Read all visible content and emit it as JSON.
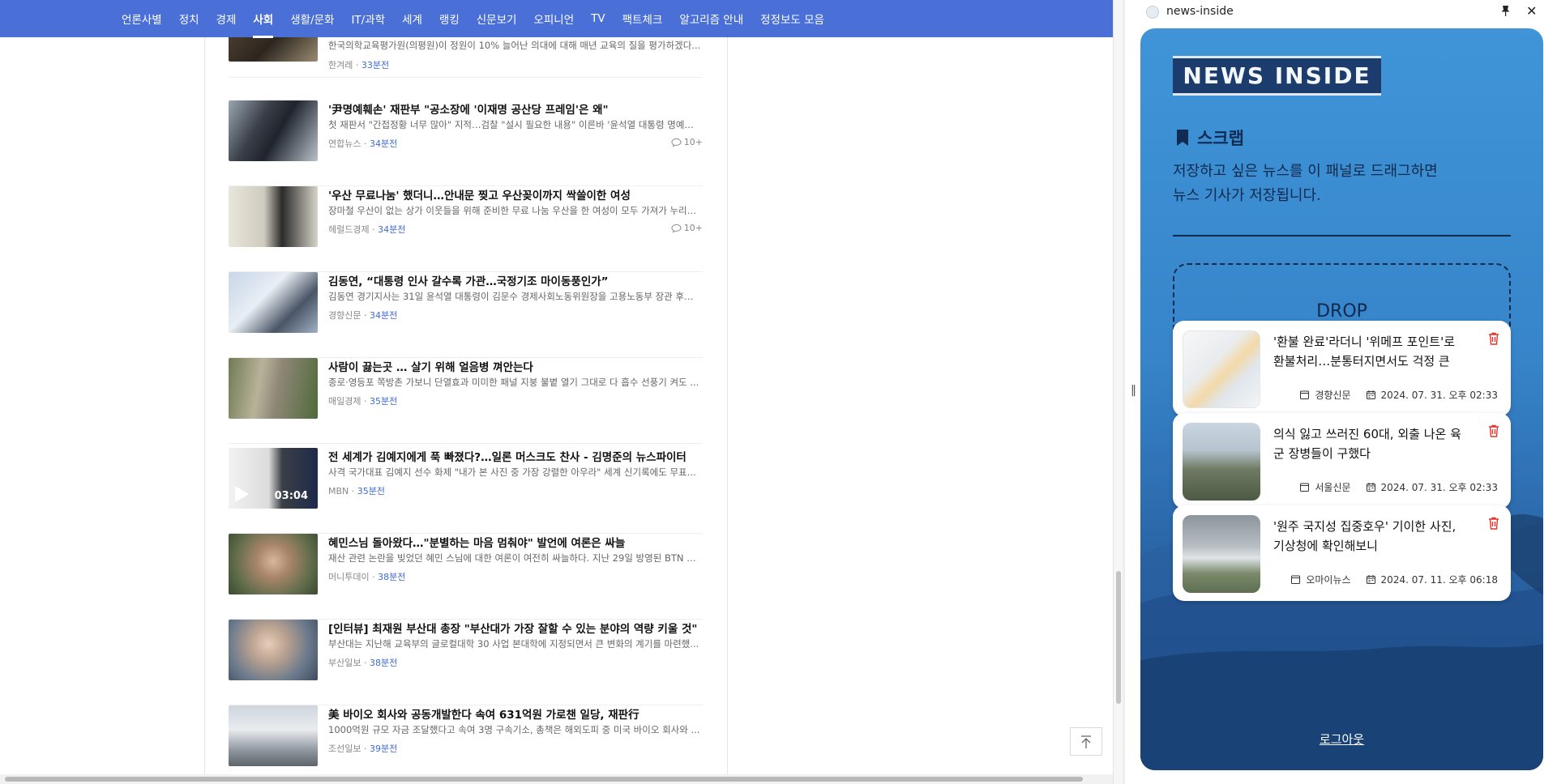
{
  "nav": {
    "items": [
      "언론사별",
      "정치",
      "경제",
      "사회",
      "생활/문화",
      "IT/과학",
      "세계",
      "랭킹",
      "신문보기",
      "오피니언",
      "TV",
      "팩트체크",
      "알고리즘 안내",
      "정정보도 모음"
    ],
    "active": "사회"
  },
  "news": [
    {
      "title": "",
      "desc": "한국의학교육평가원(의평원)이 정원이 10% 늘어난 의대에 대해 매년 교육의 질을 평가하겠다...",
      "source": "한겨레",
      "time": "33분전"
    },
    {
      "title": "'尹명예훼손' 재판부 \"공소장에 '이재명 공산당 프레임'은 왜\"",
      "desc": "첫 재판서 \"간접정황 너무 많아\" 지적…검찰 \"설시 필요한 내용\" 이른바 '윤석열 대통령 명예훼...",
      "source": "연합뉴스",
      "time": "34분전",
      "comments": "10+"
    },
    {
      "title": "'우산 무료나눔' 했더니…안내문 찢고 우산꽂이까지 싹쓸이한 여성",
      "desc": "장마철 우산이 없는 상가 이웃들을 위해 준비한 무료 나눔 우산을 한 여성이 모두 가져가 누리꾼...",
      "source": "헤럴드경제",
      "time": "34분전",
      "comments": "10+"
    },
    {
      "title": "김동연, “대통령 인사 갈수록 가관…국정기조 마이동풍인가”",
      "desc": "김동연 경기지사는 31일 윤석열 대통령이 김문수 경제사회노동위원장을 고용노동부 장관 후보...",
      "source": "경향신문",
      "time": "34분전"
    },
    {
      "title": "사람이 끓는곳 … 살기 위해 얼음병 껴안는다",
      "desc": "종로·영등포 쪽방촌 가보니 단열효과 미미한 패널 지붕 불볕 열기 그대로 다 흡수 선풍기 켜도 ...",
      "source": "매일경제",
      "time": "35분전"
    },
    {
      "title": "전 세계가 김예지에게 푹 빠졌다?…일론 머스크도 찬사 - 김명준의 뉴스파이터",
      "desc": "사격 국가대표 김예지 선수 화제 \"내가 본 사진 중 가장 강렬한 아우라\" 세계 신기록에도 무표...",
      "source": "MBN",
      "time": "35분전",
      "duration": "03:04"
    },
    {
      "title": "혜민스님 돌아왔다…\"분별하는 마음 멈춰야\" 발언에 여론은 싸늘",
      "desc": "재산 관련 논란을 빚었던 혜민 스님에 대한 여론이 여전히 싸늘하다. 지난 29일 방영된 BTN 불...",
      "source": "머니투데이",
      "time": "38분전"
    },
    {
      "title": "[인터뷰] 최재원 부산대 총장 \"부산대가 가장 잘할 수 있는 분야의 역량 키울 것\"",
      "desc": "부산대는 지난해 교육부의 글로컬대학 30 사업 본대학에 지정되면서 큰 변화의 계기를 마련했...",
      "source": "부산일보",
      "time": "38분전"
    },
    {
      "title": "美 바이오 회사와 공동개발한다 속여 631억원 가로챈 일당, 재판行",
      "desc": "1000억원 규모 자금 조달했다고 속여 3명 구속기소, 총책은 해외도피 중 미국 바이오 회사와 ...",
      "source": "조선일보",
      "time": "39분전"
    }
  ],
  "panel": {
    "window_title": "news-inside",
    "brand": "NEWS INSIDE",
    "scrap_heading": "스크랩",
    "scrap_desc_line1": "저장하고 싶은 뉴스를 이 패널로 드래그하면",
    "scrap_desc_line2": "뉴스 기사가 저장됩니다.",
    "drop_label": "DROP",
    "cards": [
      {
        "title": "'환불 완료'라더니 '위메프 포인트'로 환불처리…분통터지면서도 걱정 큰 소...",
        "source": "경향신문",
        "date": "2024. 07. 31. 오후 02:33"
      },
      {
        "title": "의식 잃고 쓰러진 60대, 외출 나온 육군 장병들이 구했다",
        "source": "서울신문",
        "date": "2024. 07. 31. 오후 02:33"
      },
      {
        "title": "'원주 국지성 집중호우' 기이한 사진, 기상청에 확인해보니",
        "source": "오마이뉴스",
        "date": "2024. 07. 11. 오후 06:18"
      }
    ],
    "logout": "로그아웃"
  },
  "colors": {
    "nav_bg": "#4a6fd6",
    "time_accent": "#3f69d6",
    "panel_top": "#3f95d8",
    "panel_bottom": "#1e4e89",
    "ink": "#10294d",
    "delete_red": "#e0342c"
  },
  "icons": {
    "comment": "comment-icon",
    "bookmark": "bookmark-icon",
    "trash": "trash-icon",
    "calendar": "calendar-icon",
    "newspaper": "newspaper-icon",
    "pin": "pin-icon",
    "close": "close-icon",
    "scroll_top": "arrow-up-icon",
    "play": "play-icon"
  }
}
